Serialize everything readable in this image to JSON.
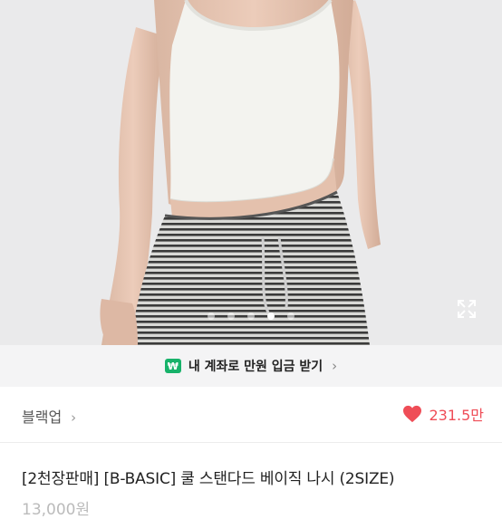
{
  "gallery": {
    "slide_count": 5,
    "active_slide": 4
  },
  "banner": {
    "badge": "₩",
    "text": "내 계좌로 만원 입금 받기",
    "chevron": "›"
  },
  "seller": {
    "name": "블랙업",
    "chevron": "›"
  },
  "likes": {
    "count": "231.5만",
    "color": "#ef4d57"
  },
  "product": {
    "title": "[2천장판매] [B-BASIC] 쿨 스탠다드 베이직 나시 (2SIZE)",
    "price": "13,000원"
  }
}
